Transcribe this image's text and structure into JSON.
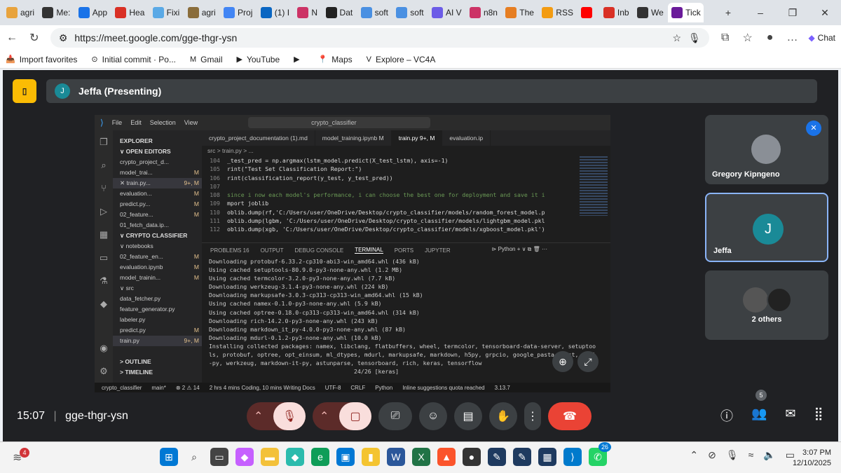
{
  "browser": {
    "tabs": [
      "agri",
      "Me:",
      "App",
      "Hea",
      "Fixi",
      "agri",
      "Proj",
      "(1) I",
      "N",
      "Dat",
      "soft",
      "soft",
      "AI V",
      "n8n",
      "The",
      "RSS",
      "",
      "Inb",
      "We",
      "Tick"
    ],
    "url": "https://meet.google.com/gge-thgr-ysn",
    "chat_label": "Chat",
    "bookmarks": [
      "Import favorites",
      "Initial commit · Po...",
      "Gmail",
      "YouTube",
      "",
      "Maps",
      "Explore – VC4A"
    ]
  },
  "meet": {
    "presenter_initial": "J",
    "presenter": "Jeffa (Presenting)",
    "meeting_code": "gge-thgr-ysn",
    "time": "15:07",
    "participants_count": "5",
    "tiles": [
      {
        "name": "Gregory Kipngeno"
      },
      {
        "name": "Jeffa",
        "initial": "J"
      },
      {
        "name": "2 others"
      }
    ]
  },
  "vscode": {
    "menu": [
      "File",
      "Edit",
      "Selection",
      "View"
    ],
    "search": "crypto_classifier",
    "tabs": [
      "crypto_project_documentation (1).md",
      "model_training.ipynb M",
      "train.py 9+, M",
      "evaluation.ip"
    ],
    "breadcrumb": "src > train.py > ...",
    "explorer": [
      {
        "t": "EXPLORER",
        "cls": "hd",
        "m": ""
      },
      {
        "t": "∨ OPEN EDITORS",
        "cls": "hd",
        "m": ""
      },
      {
        "t": "   crypto_project_d...",
        "cls": "",
        "m": ""
      },
      {
        "t": "   model_trai...",
        "cls": "",
        "m": "M"
      },
      {
        "t": "✕ train.py...",
        "cls": "sel",
        "m": "9+, M"
      },
      {
        "t": "   evaluation...",
        "cls": "",
        "m": "M"
      },
      {
        "t": "   predict.py...",
        "cls": "",
        "m": "M"
      },
      {
        "t": "   02_feature...",
        "cls": "",
        "m": "M"
      },
      {
        "t": "   01_fetch_data.ip...",
        "cls": "",
        "m": ""
      },
      {
        "t": "∨ CRYPTO CLASSIFIER",
        "cls": "hd",
        "m": ""
      },
      {
        "t": " ∨ notebooks",
        "cls": "",
        "m": ""
      },
      {
        "t": "   02_feature_en...",
        "cls": "",
        "m": "M"
      },
      {
        "t": "   evaluation.ipynb",
        "cls": "",
        "m": "M"
      },
      {
        "t": "   model_trainin...",
        "cls": "",
        "m": "M"
      },
      {
        "t": " ∨ src",
        "cls": "",
        "m": ""
      },
      {
        "t": "   data_fetcher.py",
        "cls": "",
        "m": ""
      },
      {
        "t": "   feature_generator.py",
        "cls": "",
        "m": ""
      },
      {
        "t": "   labeler.py",
        "cls": "",
        "m": ""
      },
      {
        "t": "   predict.py",
        "cls": "",
        "m": "M"
      },
      {
        "t": "   train.py",
        "cls": "sel",
        "m": "9+, M"
      },
      {
        "t": "",
        "cls": "",
        "m": ""
      },
      {
        "t": "> OUTLINE",
        "cls": "hd",
        "m": ""
      },
      {
        "t": "> TIMELINE",
        "cls": "hd",
        "m": ""
      }
    ],
    "code": [
      {
        "n": "104",
        "t": "_test_pred = np.argmax(lstm_model.predict(X_test_lstm), axis=-1)"
      },
      {
        "n": "105",
        "t": "rint(\"Test Set Classification Report:\")"
      },
      {
        "n": "106",
        "t": "rint(classification_report(y_test, y_test_pred))"
      },
      {
        "n": "107",
        "t": ""
      },
      {
        "n": "108",
        "t": "since i now each model's performance, i can choose the best one for deployment and save it i"
      },
      {
        "n": "109",
        "t": "mport joblib"
      },
      {
        "n": "110",
        "t": "oblib.dump(rf,'C:/Users/user/OneDrive/Desktop/crypto_classifier/models/random_forest_model.p"
      },
      {
        "n": "111",
        "t": "oblib.dump(lgbm, 'C:/Users/user/OneDrive/Desktop/crypto_classifier/models/lightgbm_model.pkl"
      },
      {
        "n": "112",
        "t": "oblib.dump(xgb, 'C:/Users/user/OneDrive/Desktop/crypto_classifier/models/xgboost_model.pkl')"
      }
    ],
    "panel_tabs": [
      "PROBLEMS 16",
      "OUTPUT",
      "DEBUG CONSOLE",
      "TERMINAL",
      "PORTS",
      "JUPYTER"
    ],
    "terminal": [
      "Downloading protobuf-6.33.2-cp310-abi3-win_amd64.whl (436 kB)",
      "Using cached setuptools-80.9.0-py3-none-any.whl (1.2 MB)",
      "Using cached termcolor-3.2.0-py3-none-any.whl (7.7 kB)",
      "Downloading werkzeug-3.1.4-py3-none-any.whl (224 kB)",
      "Downloading markupsafe-3.0.3-cp313-cp313-win_amd64.whl (15 kB)",
      "Using cached namex-0.1.0-py3-none-any.whl (5.9 kB)",
      "Using cached optree-0.18.0-cp313-cp313-win_amd64.whl (314 kB)",
      "Downloading rich-14.2.0-py3-none-any.whl (243 kB)",
      "Downloading markdown_it_py-4.0.0-py3-none-any.whl (87 kB)",
      "Downloading mdurl-0.1.2-py3-none-any.whl (10.0 kB)",
      "Installing collected packages: namex, libclang, flatbuffers, wheel, termcolor, tensorboard-data-server, setuptoo",
      "ls, protobuf, optree, opt_einsum, ml_dtypes, mdurl, markupsafe, markdown, h5py, grpcio, google_pasta, gast, absl",
      "-py, werkzeug, markdown-it-py, astunparse, tensorboard, rich, keras, tensorflow",
      "                                          24/26 [keras]"
    ],
    "status": [
      "crypto_classifier",
      "main*",
      "⊗ 2 ⚠ 14",
      "2 hrs 4 mins Coding, 10 mins Writing Docs",
      "UTF-8",
      "CRLF",
      "Python",
      "Inline suggestions quota reached",
      "3.13.7"
    ],
    "terminal_shell": "Python"
  },
  "taskbar": {
    "time": "3:07 PM",
    "date": "12/10/2025",
    "notif_badge": "4",
    "whatsapp_badge": "26"
  }
}
